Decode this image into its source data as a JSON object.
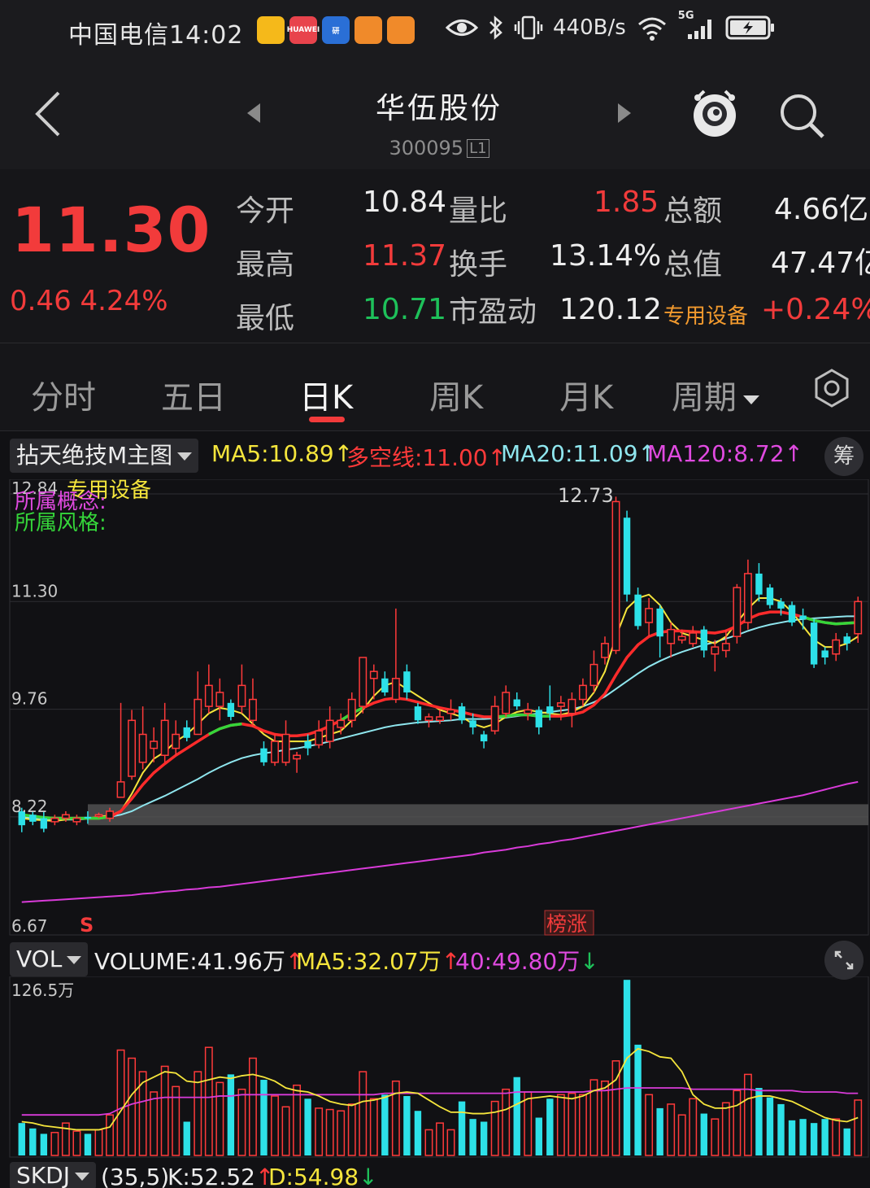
{
  "status_bar": {
    "carrier_time": "中国电信14:02",
    "apps": [
      {
        "name": "weibo-app-icon",
        "color": "#f5b91a",
        "text": ""
      },
      {
        "name": "huawei-app-icon",
        "color": "#e8434c",
        "text": "HUAWEI"
      },
      {
        "name": "research-app-icon",
        "color": "#2a6fd6",
        "text": "研"
      },
      {
        "name": "app-icon-a",
        "color": "#f08a2a",
        "text": ""
      },
      {
        "name": "app-icon-b",
        "color": "#f08a2a",
        "text": ""
      }
    ],
    "net_speed": "440B/s",
    "network": "5G"
  },
  "header": {
    "stock_name": "华伍股份",
    "stock_code": "300095",
    "level_badge": "L1"
  },
  "quote": {
    "price": "11.30",
    "change": "0.46",
    "change_pct": "4.24%",
    "rows": [
      {
        "l1": "今开",
        "v1": "10.84",
        "l2": "量比",
        "v2": "1.85",
        "l3": "总额",
        "v3": "4.66亿"
      },
      {
        "l1": "最高",
        "v1": "11.37",
        "l2": "换手",
        "v2": "13.14%",
        "l3": "总值",
        "v3": "47.47亿"
      },
      {
        "l1": "最低",
        "v1": "10.71",
        "l2": "市盈动",
        "v2": "120.12",
        "l3": "专用设备",
        "v3": "+0.24%"
      }
    ],
    "colors": {
      "up": "#f23b3b",
      "down": "#1ec15a"
    }
  },
  "tabs": {
    "items": [
      "分时",
      "五日",
      "日K",
      "周K",
      "月K",
      "周期"
    ],
    "active": "日K"
  },
  "main_indicator": {
    "selector": "拈天绝技M主图",
    "ma5": "MA5:10.89",
    "dkx": "多空线:11.00",
    "ma20": "MA20:11.09",
    "ma120": "MA120:8.72",
    "chou_label": "筹",
    "sector_label": "专用设备",
    "concept_label": "所属概念:",
    "style_label": "所属风格:",
    "y_ticks": [
      "12.84",
      "11.30",
      "9.76",
      "8.22",
      "6.67"
    ],
    "high_label": "12.73",
    "markers": {
      "sell": "S",
      "rank": "榜涨"
    }
  },
  "volume_indicator": {
    "selector": "VOL",
    "volume": "VOLUME:41.96万",
    "ma5": "MA5:32.07万",
    "ma40": "40:49.80万",
    "y_max": "126.5万"
  },
  "bottom_indicator": {
    "selector": "SKDJ",
    "params": "(35,5)",
    "k": "K:52.52",
    "d": "D:54.98"
  },
  "chart_data": {
    "type": "candlestick",
    "price_axis": {
      "min": 6.67,
      "max": 12.84
    },
    "candles": [
      {
        "o": 8.3,
        "c": 8.1,
        "h": 8.35,
        "l": 8.0
      },
      {
        "o": 8.25,
        "c": 8.15,
        "h": 8.3,
        "l": 8.1
      },
      {
        "o": 8.2,
        "c": 8.05,
        "h": 8.3,
        "l": 8.0
      },
      {
        "o": 8.15,
        "c": 8.2,
        "h": 8.25,
        "l": 8.1
      },
      {
        "o": 8.2,
        "c": 8.25,
        "h": 8.3,
        "l": 8.15
      },
      {
        "o": 8.15,
        "c": 8.2,
        "h": 8.25,
        "l": 8.1
      },
      {
        "o": 8.22,
        "c": 8.2,
        "h": 8.3,
        "l": 8.12
      },
      {
        "o": 8.25,
        "c": 8.25,
        "h": 8.28,
        "l": 8.2
      },
      {
        "o": 8.2,
        "c": 8.3,
        "h": 8.35,
        "l": 8.15
      },
      {
        "o": 8.5,
        "c": 8.72,
        "h": 9.85,
        "l": 8.5
      },
      {
        "o": 8.8,
        "c": 9.6,
        "h": 9.75,
        "l": 8.75
      },
      {
        "o": 9.0,
        "c": 9.4,
        "h": 9.8,
        "l": 8.9
      },
      {
        "o": 9.2,
        "c": 9.3,
        "h": 9.5,
        "l": 9.0
      },
      {
        "o": 9.1,
        "c": 9.6,
        "h": 9.85,
        "l": 9.0
      },
      {
        "o": 9.2,
        "c": 9.4,
        "h": 9.6,
        "l": 9.1
      },
      {
        "o": 9.5,
        "c": 9.35,
        "h": 9.6,
        "l": 9.3
      },
      {
        "o": 9.4,
        "c": 9.9,
        "h": 10.3,
        "l": 9.4
      },
      {
        "o": 9.8,
        "c": 10.1,
        "h": 10.4,
        "l": 9.7
      },
      {
        "o": 9.8,
        "c": 10.0,
        "h": 10.2,
        "l": 9.6
      },
      {
        "o": 9.85,
        "c": 9.65,
        "h": 9.9,
        "l": 9.6
      },
      {
        "o": 9.8,
        "c": 10.1,
        "h": 10.4,
        "l": 9.7
      },
      {
        "o": 9.6,
        "c": 9.9,
        "h": 10.2,
        "l": 9.5
      },
      {
        "o": 9.2,
        "c": 9.0,
        "h": 9.3,
        "l": 8.95
      },
      {
        "o": 9.0,
        "c": 9.3,
        "h": 9.4,
        "l": 8.95
      },
      {
        "o": 9.0,
        "c": 9.4,
        "h": 9.6,
        "l": 8.95
      },
      {
        "o": 9.05,
        "c": 9.1,
        "h": 9.15,
        "l": 8.85
      },
      {
        "o": 9.3,
        "c": 9.2,
        "h": 9.4,
        "l": 9.1
      },
      {
        "o": 9.25,
        "c": 9.45,
        "h": 9.6,
        "l": 9.2
      },
      {
        "o": 9.3,
        "c": 9.6,
        "h": 9.8,
        "l": 9.2
      },
      {
        "o": 9.5,
        "c": 9.6,
        "h": 9.7,
        "l": 9.4
      },
      {
        "o": 9.6,
        "c": 9.9,
        "h": 10.0,
        "l": 9.5
      },
      {
        "o": 9.8,
        "c": 10.5,
        "h": 10.5,
        "l": 9.7
      },
      {
        "o": 10.2,
        "c": 10.3,
        "h": 10.4,
        "l": 9.9
      },
      {
        "o": 10.2,
        "c": 10.0,
        "h": 10.3,
        "l": 9.95
      },
      {
        "o": 9.9,
        "c": 10.2,
        "h": 11.2,
        "l": 9.85
      },
      {
        "o": 10.3,
        "c": 10.0,
        "h": 10.4,
        "l": 9.9
      },
      {
        "o": 9.8,
        "c": 9.6,
        "h": 9.85,
        "l": 9.55
      },
      {
        "o": 9.6,
        "c": 9.65,
        "h": 9.7,
        "l": 9.5
      },
      {
        "o": 9.6,
        "c": 9.65,
        "h": 9.75,
        "l": 9.55
      },
      {
        "o": 9.7,
        "c": 9.75,
        "h": 9.9,
        "l": 9.6
      },
      {
        "o": 9.8,
        "c": 9.6,
        "h": 9.85,
        "l": 9.55
      },
      {
        "o": 9.6,
        "c": 9.5,
        "h": 9.7,
        "l": 9.4
      },
      {
        "o": 9.4,
        "c": 9.3,
        "h": 9.45,
        "l": 9.2
      },
      {
        "o": 9.45,
        "c": 9.8,
        "h": 9.95,
        "l": 9.4
      },
      {
        "o": 9.7,
        "c": 10.0,
        "h": 10.1,
        "l": 9.65
      },
      {
        "o": 9.9,
        "c": 9.8,
        "h": 10.0,
        "l": 9.75
      },
      {
        "o": 9.7,
        "c": 9.75,
        "h": 9.85,
        "l": 9.6
      },
      {
        "o": 9.75,
        "c": 9.5,
        "h": 9.8,
        "l": 9.4
      },
      {
        "o": 9.8,
        "c": 9.7,
        "h": 10.1,
        "l": 9.6
      },
      {
        "o": 9.8,
        "c": 9.85,
        "h": 9.95,
        "l": 9.6
      },
      {
        "o": 9.7,
        "c": 9.9,
        "h": 10.0,
        "l": 9.5
      },
      {
        "o": 9.9,
        "c": 10.1,
        "h": 10.2,
        "l": 9.8
      },
      {
        "o": 10.1,
        "c": 10.4,
        "h": 10.6,
        "l": 10.0
      },
      {
        "o": 10.5,
        "c": 10.7,
        "h": 10.8,
        "l": 10.4
      },
      {
        "o": 10.6,
        "c": 12.73,
        "h": 12.8,
        "l": 10.55
      },
      {
        "o": 12.5,
        "c": 11.4,
        "h": 12.6,
        "l": 11.3
      },
      {
        "o": 11.4,
        "c": 10.95,
        "h": 11.5,
        "l": 10.9
      },
      {
        "o": 11.0,
        "c": 11.2,
        "h": 11.35,
        "l": 10.8
      },
      {
        "o": 11.2,
        "c": 10.8,
        "h": 11.25,
        "l": 10.5
      },
      {
        "o": 10.7,
        "c": 10.9,
        "h": 11.0,
        "l": 10.5
      },
      {
        "o": 10.75,
        "c": 10.8,
        "h": 10.9,
        "l": 10.7
      },
      {
        "o": 10.7,
        "c": 10.85,
        "h": 10.95,
        "l": 10.65
      },
      {
        "o": 10.9,
        "c": 10.6,
        "h": 10.95,
        "l": 10.5
      },
      {
        "o": 10.55,
        "c": 10.65,
        "h": 10.75,
        "l": 10.3
      },
      {
        "o": 10.6,
        "c": 10.7,
        "h": 10.9,
        "l": 10.5
      },
      {
        "o": 10.8,
        "c": 11.5,
        "h": 11.55,
        "l": 10.7
      },
      {
        "o": 11.0,
        "c": 11.7,
        "h": 11.9,
        "l": 10.9
      },
      {
        "o": 11.7,
        "c": 11.4,
        "h": 11.85,
        "l": 11.3
      },
      {
        "o": 11.5,
        "c": 11.25,
        "h": 11.55,
        "l": 11.2
      },
      {
        "o": 11.3,
        "c": 11.2,
        "h": 11.35,
        "l": 11.1
      },
      {
        "o": 11.25,
        "c": 11.0,
        "h": 11.3,
        "l": 10.95
      },
      {
        "o": 11.1,
        "c": 11.05,
        "h": 11.2,
        "l": 10.9
      },
      {
        "o": 11.0,
        "c": 10.4,
        "h": 11.05,
        "l": 10.35
      },
      {
        "o": 10.6,
        "c": 10.5,
        "h": 10.65,
        "l": 10.4
      },
      {
        "o": 10.55,
        "c": 10.75,
        "h": 10.85,
        "l": 10.45
      },
      {
        "o": 10.8,
        "c": 10.7,
        "h": 10.85,
        "l": 10.6
      },
      {
        "o": 10.84,
        "c": 11.3,
        "h": 11.37,
        "l": 10.71
      }
    ],
    "ma5": [
      8.2,
      8.18,
      8.17,
      8.16,
      8.18,
      8.2,
      8.2,
      8.22,
      8.24,
      8.3,
      8.55,
      8.85,
      9.05,
      9.15,
      9.3,
      9.4,
      9.55,
      9.7,
      9.78,
      9.75,
      9.7,
      9.55,
      9.4,
      9.3,
      9.3,
      9.3,
      9.3,
      9.35,
      9.4,
      9.45,
      9.6,
      9.75,
      9.95,
      10.1,
      10.15,
      10.05,
      9.95,
      9.85,
      9.75,
      9.7,
      9.65,
      9.55,
      9.5,
      9.55,
      9.65,
      9.72,
      9.75,
      9.72,
      9.7,
      9.68,
      9.72,
      9.8,
      10.0,
      10.3,
      10.8,
      11.2,
      11.35,
      11.4,
      11.25,
      11.0,
      10.85,
      10.8,
      10.75,
      10.7,
      10.8,
      11.0,
      11.2,
      11.35,
      11.35,
      11.3,
      11.15,
      10.95,
      10.75,
      10.65,
      10.65,
      10.7,
      10.8
    ],
    "ma20": [
      8.22,
      8.2,
      8.19,
      8.18,
      8.18,
      8.18,
      8.19,
      8.2,
      8.22,
      8.25,
      8.3,
      8.38,
      8.45,
      8.52,
      8.6,
      8.68,
      8.76,
      8.85,
      8.93,
      9.0,
      9.06,
      9.1,
      9.13,
      9.15,
      9.18,
      9.2,
      9.23,
      9.26,
      9.3,
      9.34,
      9.38,
      9.42,
      9.46,
      9.5,
      9.53,
      9.55,
      9.57,
      9.58,
      9.59,
      9.6,
      9.62,
      9.62,
      9.62,
      9.63,
      9.64,
      9.66,
      9.68,
      9.7,
      9.72,
      9.74,
      9.76,
      9.8,
      9.86,
      9.94,
      10.05,
      10.16,
      10.27,
      10.37,
      10.45,
      10.52,
      10.58,
      10.63,
      10.68,
      10.72,
      10.77,
      10.82,
      10.88,
      10.93,
      10.97,
      11.0,
      11.03,
      11.05,
      11.06,
      11.07,
      11.08,
      11.09,
      11.09
    ],
    "dkx": [
      8.25,
      8.23,
      8.21,
      8.2,
      8.2,
      8.2,
      8.2,
      8.2,
      8.22,
      8.3,
      8.48,
      8.68,
      8.85,
      8.98,
      9.1,
      9.2,
      9.3,
      9.4,
      9.48,
      9.53,
      9.55,
      9.52,
      9.45,
      9.4,
      9.38,
      9.38,
      9.4,
      9.45,
      9.52,
      9.6,
      9.7,
      9.78,
      9.85,
      9.9,
      9.92,
      9.9,
      9.86,
      9.82,
      9.78,
      9.75,
      9.72,
      9.68,
      9.65,
      9.65,
      9.66,
      9.68,
      9.68,
      9.66,
      9.66,
      9.66,
      9.68,
      9.72,
      9.82,
      9.98,
      10.25,
      10.5,
      10.68,
      10.8,
      10.86,
      10.88,
      10.88,
      10.87,
      10.86,
      10.85,
      10.88,
      10.95,
      11.05,
      11.12,
      11.15,
      11.15,
      11.12,
      11.08,
      11.03,
      11.0,
      10.98,
      10.99,
      11.0
    ],
    "dkx_green_ranges": [
      [
        0,
        8
      ],
      [
        17,
        20
      ],
      [
        29,
        31
      ],
      [
        43,
        48
      ],
      [
        71,
        76
      ]
    ],
    "ma120": [
      7.0,
      7.01,
      7.02,
      7.03,
      7.04,
      7.05,
      7.06,
      7.07,
      7.08,
      7.09,
      7.1,
      7.12,
      7.13,
      7.15,
      7.16,
      7.18,
      7.19,
      7.21,
      7.22,
      7.24,
      7.26,
      7.28,
      7.3,
      7.32,
      7.34,
      7.36,
      7.38,
      7.4,
      7.42,
      7.44,
      7.46,
      7.48,
      7.5,
      7.52,
      7.54,
      7.56,
      7.58,
      7.6,
      7.62,
      7.64,
      7.66,
      7.68,
      7.71,
      7.73,
      7.75,
      7.78,
      7.8,
      7.83,
      7.85,
      7.88,
      7.9,
      7.93,
      7.96,
      7.99,
      8.02,
      8.05,
      8.08,
      8.11,
      8.14,
      8.17,
      8.2,
      8.23,
      8.26,
      8.29,
      8.32,
      8.35,
      8.38,
      8.41,
      8.44,
      8.47,
      8.5,
      8.53,
      8.57,
      8.61,
      8.65,
      8.69,
      8.72
    ],
    "support_band": {
      "from": 8.1,
      "to": 8.4
    },
    "volume": {
      "max": 126.5,
      "values": [
        24,
        20,
        16,
        17,
        24,
        18,
        16,
        19,
        30,
        78,
        72,
        62,
        47,
        66,
        51,
        25,
        62,
        80,
        54,
        60,
        49,
        72,
        56,
        44,
        36,
        52,
        42,
        35,
        34,
        33,
        38,
        62,
        42,
        45,
        55,
        44,
        33,
        19,
        24,
        19,
        40,
        27,
        25,
        40,
        49,
        58,
        47,
        28,
        42,
        45,
        46,
        45,
        56,
        55,
        70,
        130,
        82,
        45,
        35,
        38,
        30,
        42,
        31,
        27,
        39,
        48,
        60,
        50,
        43,
        38,
        26,
        27,
        24,
        27,
        27,
        20,
        41
      ],
      "ma5": [
        25,
        24,
        22,
        21,
        20,
        19,
        19,
        19,
        21,
        33,
        45,
        54,
        58,
        62,
        61,
        55,
        54,
        56,
        58,
        57,
        59,
        60,
        58,
        55,
        50,
        48,
        47,
        44,
        40,
        38,
        37,
        40,
        41,
        43,
        46,
        47,
        46,
        41,
        36,
        32,
        32,
        31,
        31,
        32,
        34,
        38,
        42,
        43,
        44,
        43,
        42,
        44,
        48,
        50,
        56,
        72,
        79,
        77,
        73,
        72,
        62,
        45,
        38,
        35,
        35,
        37,
        42,
        44,
        44,
        42,
        40,
        36,
        32,
        28,
        26,
        25,
        28
      ],
      "ma40": [
        30,
        30,
        30,
        30,
        30,
        30,
        30,
        30,
        31,
        35,
        38,
        40,
        42,
        43,
        43,
        43,
        43,
        43,
        44,
        44,
        45,
        45,
        45,
        45,
        45,
        45,
        45,
        45,
        45,
        45,
        45,
        45,
        45,
        46,
        46,
        46,
        46,
        46,
        46,
        46,
        46,
        46,
        46,
        46,
        46,
        47,
        47,
        47,
        47,
        47,
        47,
        47,
        48,
        48,
        49,
        50,
        50,
        50,
        50,
        50,
        50,
        49,
        49,
        49,
        49,
        49,
        49,
        48,
        48,
        48,
        48,
        47,
        47,
        47,
        47,
        46,
        46
      ],
      "colors": {
        "up": "#ff3a3a",
        "down": "#2de1e8"
      }
    },
    "line_colors": {
      "ma5": "#f5e53c",
      "ma20": "#8fe6ee",
      "ma120": "#d93bd9",
      "dkx_up": "#ff2b2b",
      "dkx_down": "#35d63a"
    },
    "grid": true
  }
}
